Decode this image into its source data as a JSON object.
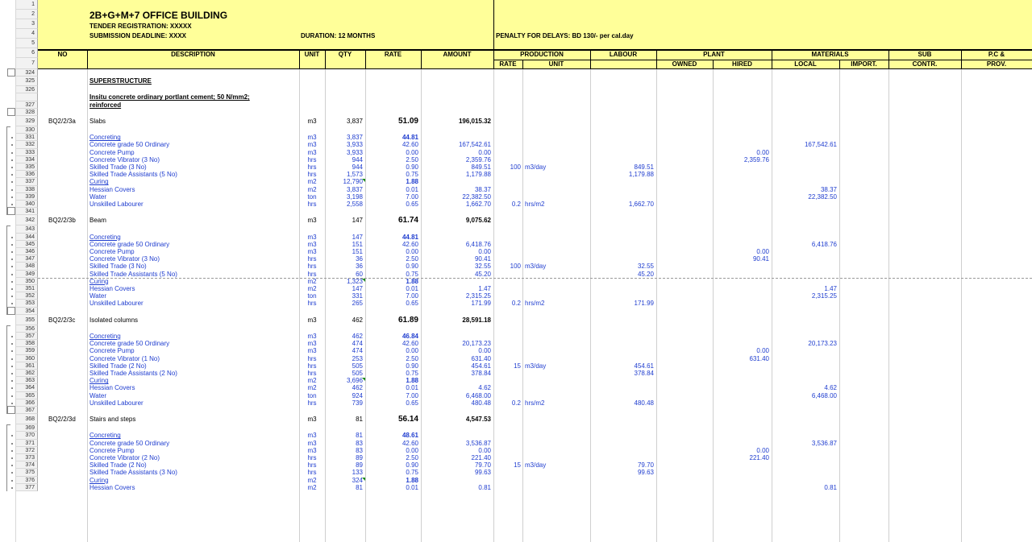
{
  "header": {
    "title": "2B+G+M+7 OFFICE BUILDING",
    "tender": "TENDER REGISTRATION: XXXXX",
    "deadline": "SUBMISSION DEADLINE:  XXXX",
    "duration": "DURATION: 12 MONTHS",
    "penalty": "PENALTY FOR DELAYS: BD 130/- per cal.day"
  },
  "columns": {
    "no": "NO",
    "description": "DESCRIPTION",
    "unit": "UNIT",
    "qty": "QTY",
    "rate": "RATE",
    "amount": "AMOUNT",
    "production": "PRODUCTION",
    "prod_rate": "RATE",
    "prod_unit": "UNIT",
    "labour": "LABOUR",
    "plant": "PLANT",
    "owned": "OWNED",
    "hired": "HIRED",
    "materials": "MATERIALS",
    "local": "LOCAL",
    "import": "IMPORT.",
    "sub": "SUB",
    "contr": "CONTR.",
    "pc": "P.C &",
    "prov": "PROV."
  },
  "header_row_numbers": [
    "1",
    "2",
    "3",
    "4",
    "5",
    "6",
    "7"
  ],
  "rows": [
    {
      "rn": "324"
    },
    {
      "rn": "325",
      "desc": "SUPERSTRUCTURE",
      "type": "section"
    },
    {
      "rn": "326"
    },
    {
      "rn": "",
      "desc": "Insitu concrete ordinary portlant cement; 50 N/mm2;",
      "type": "spec"
    },
    {
      "rn": "327",
      "desc": "reinforced",
      "type": "spec"
    },
    {
      "rn": "328"
    },
    {
      "rn": "329",
      "no": "BQ2/2/3a",
      "desc": "Slabs",
      "unit": "m3",
      "qty": "3,837",
      "rate": "51.09",
      "amount": "196,015.32",
      "type": "item"
    },
    {
      "rn": "330"
    },
    {
      "rn": "331",
      "desc": "Concreting",
      "unit": "m3",
      "qty": "3,837",
      "rate": "44.81",
      "type": "sub"
    },
    {
      "rn": "332",
      "desc": "Concrete grade 50 Ordinary",
      "unit": "m3",
      "qty": "3,933",
      "rate": "42.60",
      "amount": "167,542.61",
      "local": "167,542.61",
      "type": "line"
    },
    {
      "rn": "333",
      "desc": "Concrete Pump",
      "unit": "m3",
      "qty": "3,933",
      "rate": "0.00",
      "amount": "0.00",
      "hired": "0.00",
      "type": "line"
    },
    {
      "rn": "334",
      "desc": "Concrete Vibrator (3 No)",
      "unit": "hrs",
      "qty": "944",
      "rate": "2.50",
      "amount": "2,359.76",
      "hired": "2,359.76",
      "type": "line"
    },
    {
      "rn": "335",
      "desc": "Skilled Trade (3 No)",
      "unit": "hrs",
      "qty": "944",
      "rate": "0.90",
      "amount": "849.51",
      "prate": "100",
      "punit": "m3/day",
      "labour": "849.51",
      "type": "line"
    },
    {
      "rn": "336",
      "desc": "Skilled Trade Assistants (5 No)",
      "unit": "hrs",
      "qty": "1,573",
      "rate": "0.75",
      "amount": "1,179.88",
      "labour": "1,179.88",
      "type": "line"
    },
    {
      "rn": "337",
      "desc": "Curing",
      "unit": "m2",
      "qty": "12,790",
      "rate": "1.88",
      "type": "sub",
      "flag": true
    },
    {
      "rn": "338",
      "desc": "Hessian Covers",
      "unit": "m2",
      "qty": "3,837",
      "rate": "0.01",
      "amount": "38.37",
      "local": "38.37",
      "type": "line"
    },
    {
      "rn": "339",
      "desc": "Water",
      "unit": "ton",
      "qty": "3,198",
      "rate": "7.00",
      "amount": "22,382.50",
      "local": "22,382.50",
      "type": "line"
    },
    {
      "rn": "340",
      "desc": "Unskilled Labourer",
      "unit": "hrs",
      "qty": "2,558",
      "rate": "0.65",
      "amount": "1,662.70",
      "prate": "0.2",
      "punit": "hrs/m2",
      "labour": "1,662.70",
      "type": "line"
    },
    {
      "rn": "341"
    },
    {
      "rn": "342",
      "no": "BQ2/2/3b",
      "desc": "Beam",
      "unit": "m3",
      "qty": "147",
      "rate": "61.74",
      "amount": "9,075.62",
      "type": "item"
    },
    {
      "rn": "343"
    },
    {
      "rn": "344",
      "desc": "Concreting",
      "unit": "m3",
      "qty": "147",
      "rate": "44.81",
      "type": "sub"
    },
    {
      "rn": "345",
      "desc": "Concrete grade 50 Ordinary",
      "unit": "m3",
      "qty": "151",
      "rate": "42.60",
      "amount": "6,418.76",
      "local": "6,418.76",
      "type": "line"
    },
    {
      "rn": "346",
      "desc": "Concrete Pump",
      "unit": "m3",
      "qty": "151",
      "rate": "0.00",
      "amount": "0.00",
      "hired": "0.00",
      "type": "line"
    },
    {
      "rn": "347",
      "desc": "Concrete Vibrator (3 No)",
      "unit": "hrs",
      "qty": "36",
      "rate": "2.50",
      "amount": "90.41",
      "hired": "90.41",
      "type": "line"
    },
    {
      "rn": "348",
      "desc": "Skilled Trade (3 No)",
      "unit": "hrs",
      "qty": "36",
      "rate": "0.90",
      "amount": "32.55",
      "prate": "100",
      "punit": "m3/day",
      "labour": "32.55",
      "type": "line"
    },
    {
      "rn": "349",
      "desc": "Skilled Trade Assistants (5 No)",
      "unit": "hrs",
      "qty": "60",
      "rate": "0.75",
      "amount": "45.20",
      "labour": "45.20",
      "type": "line",
      "pagebreak": true
    },
    {
      "rn": "350",
      "desc": "Curing",
      "unit": "m2",
      "qty": "1,323",
      "rate": "1.88",
      "type": "sub",
      "flag": true
    },
    {
      "rn": "351",
      "desc": "Hessian Covers",
      "unit": "m2",
      "qty": "147",
      "rate": "0.01",
      "amount": "1.47",
      "local": "1.47",
      "type": "line"
    },
    {
      "rn": "352",
      "desc": "Water",
      "unit": "ton",
      "qty": "331",
      "rate": "7.00",
      "amount": "2,315.25",
      "local": "2,315.25",
      "type": "line"
    },
    {
      "rn": "353",
      "desc": "Unskilled Labourer",
      "unit": "hrs",
      "qty": "265",
      "rate": "0.65",
      "amount": "171.99",
      "prate": "0.2",
      "punit": "hrs/m2",
      "labour": "171.99",
      "type": "line"
    },
    {
      "rn": "354"
    },
    {
      "rn": "355",
      "no": "BQ2/2/3c",
      "desc": "Isolated columns",
      "unit": "m3",
      "qty": "462",
      "rate": "61.89",
      "amount": "28,591.18",
      "type": "item"
    },
    {
      "rn": "356"
    },
    {
      "rn": "357",
      "desc": "Concreting",
      "unit": "m3",
      "qty": "462",
      "rate": "46.84",
      "type": "sub"
    },
    {
      "rn": "358",
      "desc": "Concrete grade 50 Ordinary",
      "unit": "m3",
      "qty": "474",
      "rate": "42.60",
      "amount": "20,173.23",
      "local": "20,173.23",
      "type": "line"
    },
    {
      "rn": "359",
      "desc": "Concrete Pump",
      "unit": "m3",
      "qty": "474",
      "rate": "0.00",
      "amount": "0.00",
      "hired": "0.00",
      "type": "line"
    },
    {
      "rn": "360",
      "desc": "Concrete Vibrator (1 No)",
      "unit": "hrs",
      "qty": "253",
      "rate": "2.50",
      "amount": "631.40",
      "hired": "631.40",
      "type": "line"
    },
    {
      "rn": "361",
      "desc": "Skilled Trade (2 No)",
      "unit": "hrs",
      "qty": "505",
      "rate": "0.90",
      "amount": "454.61",
      "prate": "15",
      "punit": "m3/day",
      "labour": "454.61",
      "type": "line"
    },
    {
      "rn": "362",
      "desc": "Skilled Trade Assistants (2 No)",
      "unit": "hrs",
      "qty": "505",
      "rate": "0.75",
      "amount": "378.84",
      "labour": "378.84",
      "type": "line"
    },
    {
      "rn": "363",
      "desc": "Curing",
      "unit": "m2",
      "qty": "3,696",
      "rate": "1.88",
      "type": "sub",
      "flag": true
    },
    {
      "rn": "364",
      "desc": "Hessian Covers",
      "unit": "m2",
      "qty": "462",
      "rate": "0.01",
      "amount": "4.62",
      "local": "4.62",
      "type": "line"
    },
    {
      "rn": "365",
      "desc": "Water",
      "unit": "ton",
      "qty": "924",
      "rate": "7.00",
      "amount": "6,468.00",
      "local": "6,468.00",
      "type": "line"
    },
    {
      "rn": "366",
      "desc": "Unskilled Labourer",
      "unit": "hrs",
      "qty": "739",
      "rate": "0.65",
      "amount": "480.48",
      "prate": "0.2",
      "punit": "hrs/m2",
      "labour": "480.48",
      "type": "line"
    },
    {
      "rn": "367"
    },
    {
      "rn": "368",
      "no": "BQ2/2/3d",
      "desc": "Stairs and steps",
      "unit": "m3",
      "qty": "81",
      "rate": "56.14",
      "amount": "4,547.53",
      "type": "item"
    },
    {
      "rn": "369"
    },
    {
      "rn": "370",
      "desc": "Concreting",
      "unit": "m3",
      "qty": "81",
      "rate": "48.61",
      "type": "sub"
    },
    {
      "rn": "371",
      "desc": "Concrete grade 50 Ordinary",
      "unit": "m3",
      "qty": "83",
      "rate": "42.60",
      "amount": "3,536.87",
      "local": "3,536.87",
      "type": "line"
    },
    {
      "rn": "372",
      "desc": "Concrete Pump",
      "unit": "m3",
      "qty": "83",
      "rate": "0.00",
      "amount": "0.00",
      "hired": "0.00",
      "type": "line"
    },
    {
      "rn": "373",
      "desc": "Concrete Vibrator (2 No)",
      "unit": "hrs",
      "qty": "89",
      "rate": "2.50",
      "amount": "221.40",
      "hired": "221.40",
      "type": "line"
    },
    {
      "rn": "374",
      "desc": "Skilled Trade (2 No)",
      "unit": "hrs",
      "qty": "89",
      "rate": "0.90",
      "amount": "79.70",
      "prate": "15",
      "punit": "m3/day",
      "labour": "79.70",
      "type": "line"
    },
    {
      "rn": "375",
      "desc": "Skilled Trade Assistants (3 No)",
      "unit": "hrs",
      "qty": "133",
      "rate": "0.75",
      "amount": "99.63",
      "labour": "99.63",
      "type": "line"
    },
    {
      "rn": "376",
      "desc": "Curing",
      "unit": "m2",
      "qty": "324",
      "rate": "1.88",
      "type": "sub",
      "flag": true
    },
    {
      "rn": "377",
      "desc": "Hessian Covers",
      "unit": "m2",
      "qty": "81",
      "rate": "0.01",
      "amount": "0.81",
      "local": "0.81",
      "type": "line"
    }
  ]
}
